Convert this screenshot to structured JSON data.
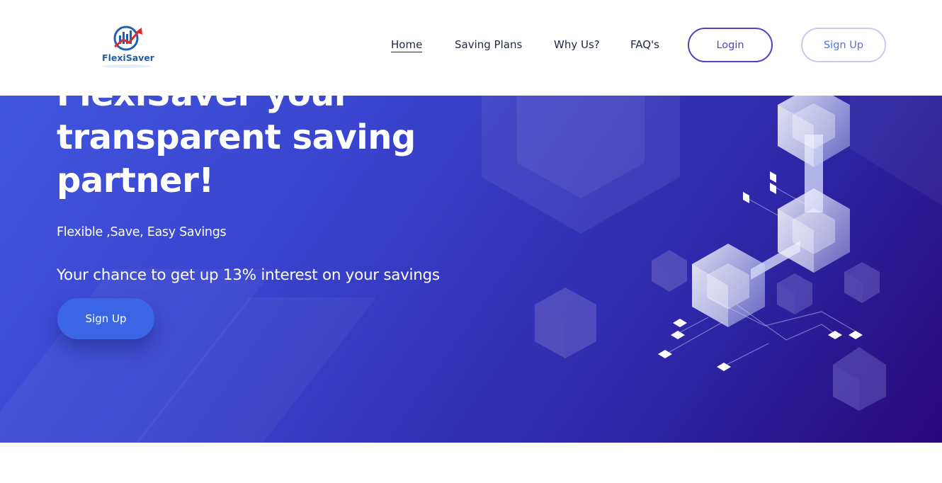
{
  "brand": {
    "name": "FlexiSaver"
  },
  "nav": {
    "items": [
      {
        "label": "Home",
        "active": true
      },
      {
        "label": "Saving Plans",
        "active": false
      },
      {
        "label": "Why Us?",
        "active": false
      },
      {
        "label": "FAQ's",
        "active": false
      }
    ],
    "login_label": "Login",
    "signup_label": "Sign Up"
  },
  "hero": {
    "title": "FlexiSaver your transparent saving partner!",
    "tagline": "Flexible ,Save, Easy Savings",
    "promo": "Your chance to get up 13% interest on your savings",
    "cta_label": "Sign Up"
  },
  "colors": {
    "hero_gradient_start": "#4159e0",
    "hero_gradient_end": "#27087a",
    "accent": "#5a3fc6",
    "cta": "#3a66e6",
    "logo_blue": "#1f5fae",
    "logo_red": "#e02b2b"
  }
}
